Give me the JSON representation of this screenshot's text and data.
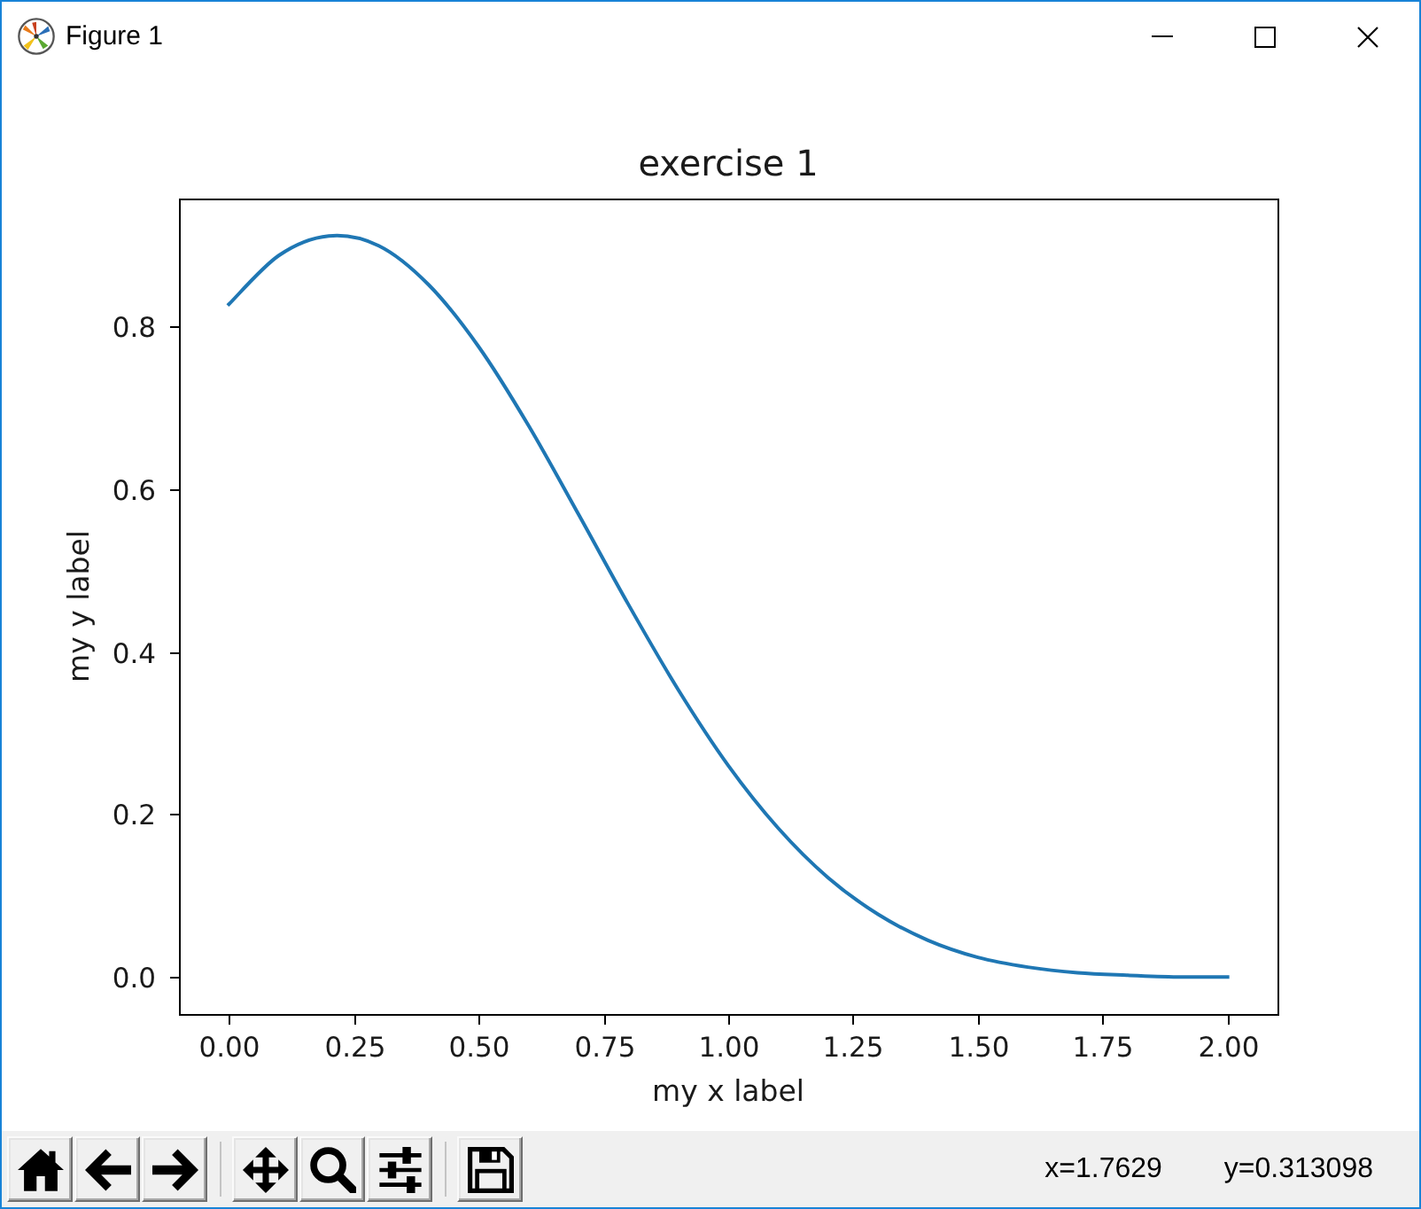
{
  "window": {
    "title": "Figure 1"
  },
  "figure": {
    "chart_data": {
      "type": "line",
      "title": "exercise 1",
      "xlabel": "my x label",
      "ylabel": "my y label",
      "x": [
        0,
        0.1,
        0.2,
        0.3,
        0.4,
        0.5,
        0.6,
        0.7,
        0.8,
        0.9,
        1,
        1.1,
        1.2,
        1.3,
        1.4,
        1.5,
        1.6,
        1.7,
        1.8,
        1.9,
        2
      ],
      "series": [
        {
          "color": "#1f77b4",
          "values": [
            0.827,
            0.887,
            0.911,
            0.899,
            0.851,
            0.775,
            0.678,
            0.569,
            0.458,
            0.353,
            0.26,
            0.183,
            0.122,
            0.077,
            0.045,
            0.024,
            0.012,
            0.005,
            0.002,
            0,
            0
          ]
        }
      ],
      "xlim": [
        -0.1,
        2.1
      ],
      "ylim": [
        -0.0456,
        0.957
      ],
      "xticks": [
        {
          "value": 0,
          "label": "0.00"
        },
        {
          "value": 0.25,
          "label": "0.25"
        },
        {
          "value": 0.5,
          "label": "0.50"
        },
        {
          "value": 0.75,
          "label": "0.75"
        },
        {
          "value": 1,
          "label": "1.00"
        },
        {
          "value": 1.25,
          "label": "1.25"
        },
        {
          "value": 1.5,
          "label": "1.50"
        },
        {
          "value": 1.75,
          "label": "1.75"
        },
        {
          "value": 2,
          "label": "2.00"
        }
      ],
      "yticks": [
        {
          "value": 0,
          "label": "0.0"
        },
        {
          "value": 0.2,
          "label": "0.2"
        },
        {
          "value": 0.4,
          "label": "0.4"
        },
        {
          "value": 0.6,
          "label": "0.6"
        },
        {
          "value": 0.8,
          "label": "0.8"
        }
      ]
    }
  },
  "toolbar": {
    "coordinates": [
      "x=1.7629",
      "y=0.313098"
    ]
  }
}
